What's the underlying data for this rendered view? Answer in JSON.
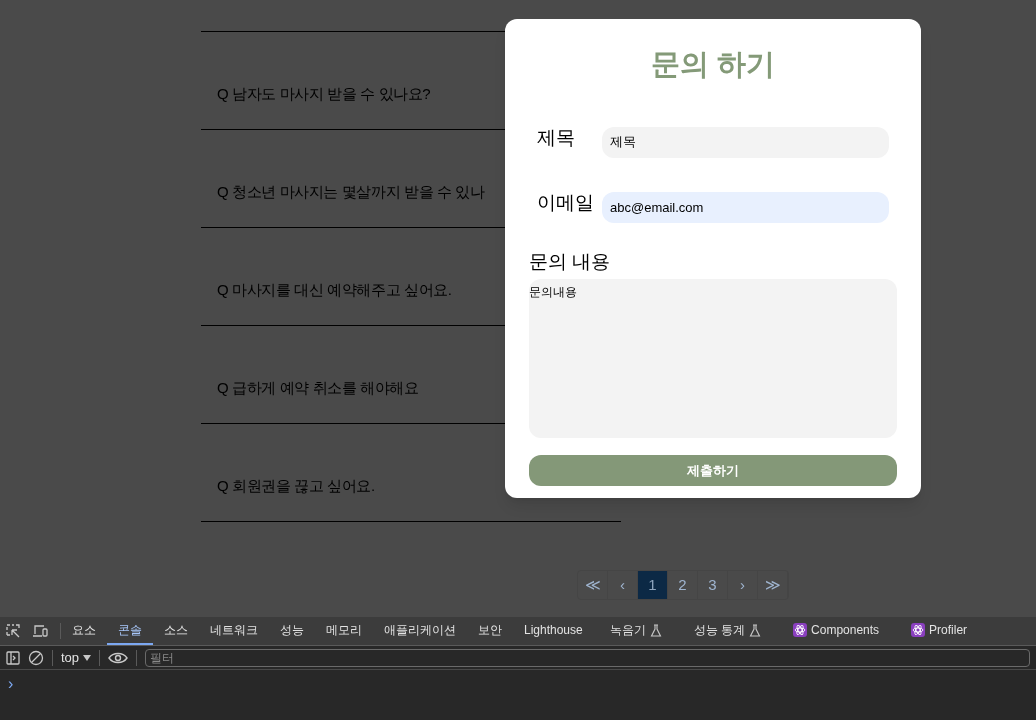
{
  "faq": {
    "items": [
      {
        "question": "Q 남자도 마사지 받을 수 있나요?"
      },
      {
        "question": "Q 청소년 마사지는 몇살까지 받을 수 있나"
      },
      {
        "question": "Q 마사지를 대신 예약해주고 싶어요."
      },
      {
        "question": "Q 급하게 예약 취소를 해야해요"
      },
      {
        "question": "Q 회원권을 끊고 싶어요."
      }
    ]
  },
  "pagination": {
    "first": "≪",
    "prev": "‹",
    "pages": [
      {
        "label": "1",
        "selected": true
      },
      {
        "label": "2",
        "selected": false
      },
      {
        "label": "3",
        "selected": false
      }
    ],
    "next": "›",
    "last": "≫"
  },
  "modal": {
    "title": "문의 하기",
    "fields": [
      {
        "kind": "text",
        "label": "제목",
        "value": "제목"
      },
      {
        "kind": "email",
        "label": "이메일",
        "value": "abc@email.com"
      }
    ],
    "message": {
      "label": "문의 내용",
      "value": "문의내용"
    },
    "submit": "제출하기"
  },
  "devtools": {
    "tabs": [
      {
        "label": "요소",
        "kind": "plain",
        "selected": false
      },
      {
        "label": "콘솔",
        "kind": "plain",
        "selected": true
      },
      {
        "label": "소스",
        "kind": "plain",
        "selected": false
      },
      {
        "label": "네트워크",
        "kind": "plain",
        "selected": false
      },
      {
        "label": "성능",
        "kind": "plain",
        "selected": false
      },
      {
        "label": "메모리",
        "kind": "plain",
        "selected": false
      },
      {
        "label": "애플리케이션",
        "kind": "plain",
        "selected": false
      },
      {
        "label": "보안",
        "kind": "plain",
        "selected": false
      },
      {
        "label": "Lighthouse",
        "kind": "plain",
        "selected": false
      },
      {
        "label": "녹음기",
        "kind": "experimental",
        "selected": false
      },
      {
        "label": "성능 통계",
        "kind": "experimental",
        "selected": false
      },
      {
        "label": "Components",
        "kind": "react",
        "selected": false
      },
      {
        "label": "Profiler",
        "kind": "react",
        "selected": false
      }
    ],
    "context": "top",
    "filter": {
      "placeholder": "필터"
    },
    "prompt": "›"
  }
}
